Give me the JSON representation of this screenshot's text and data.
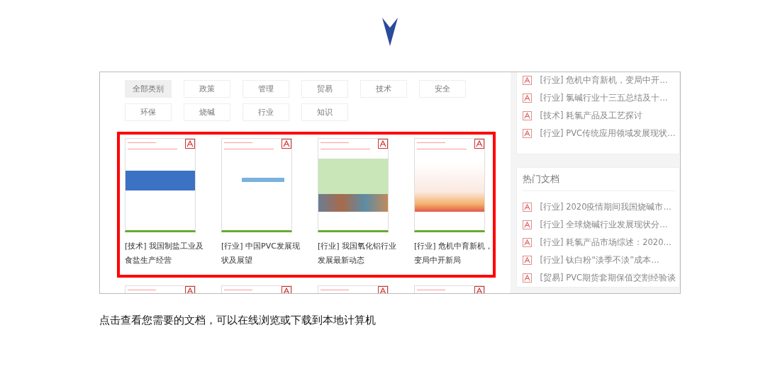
{
  "filters": [
    {
      "label": "全部类别",
      "selected": true
    },
    {
      "label": "政策",
      "selected": false
    },
    {
      "label": "管理",
      "selected": false
    },
    {
      "label": "贸易",
      "selected": false
    },
    {
      "label": "技术",
      "selected": false
    },
    {
      "label": "安全",
      "selected": false
    },
    {
      "label": "环保",
      "selected": false
    },
    {
      "label": "烧碱",
      "selected": false
    },
    {
      "label": "行业",
      "selected": false
    },
    {
      "label": "知识",
      "selected": false
    }
  ],
  "documents": [
    {
      "title": "[技术] 我国制盐工业及食盐生产经营",
      "kind": "blue-band"
    },
    {
      "title": "[行业] 中国PVC发展现状及展望",
      "kind": "plain"
    },
    {
      "title": "[行业] 我国氧化铝行业发展最新动态",
      "kind": "photo-strip"
    },
    {
      "title": "[行业] 危机中育新机，变局中开新局",
      "kind": "festive"
    }
  ],
  "sidebar": {
    "recent": [
      "[行业] 危机中育新机，变局中开…",
      "[行业] 氯碱行业十三五总结及十…",
      "[技术] 耗氯产品及工艺探讨",
      "[行业] PVC传统应用领域发展现状…"
    ],
    "hot": {
      "title": "热门文档",
      "items": [
        "[行业] 2020疫情期间我国烧碱市…",
        "[行业] 全球烧碱行业发展现状分…",
        "[行业] 耗氯产品市场综述：2020…",
        "[行业] 钛白粉“淡季不淡”成本…",
        "[贸易] PVC期货套期保值交割经验谈"
      ]
    }
  },
  "caption": "点击查看您需要的文档，可以在线浏览或下载到本地计算机"
}
